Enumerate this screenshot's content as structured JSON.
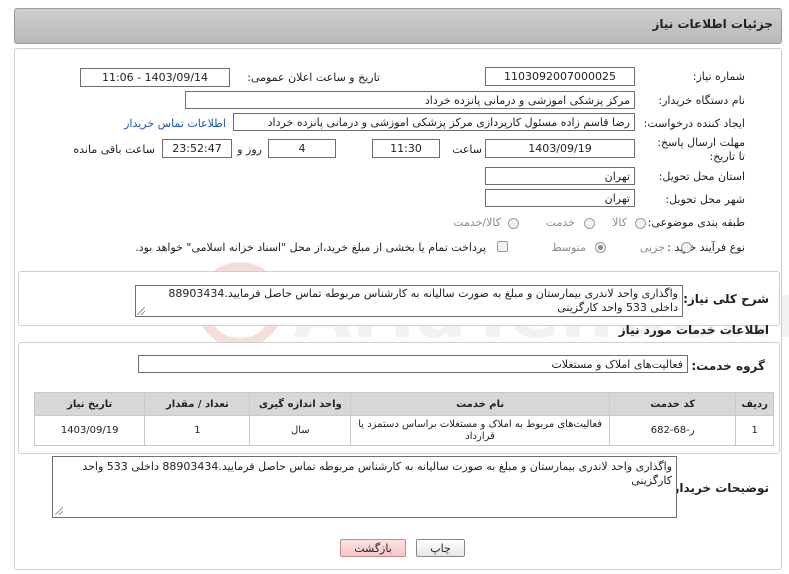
{
  "header": {
    "title": "جزئیات اطلاعات نیاز"
  },
  "form": {
    "need_number_label": "شماره نیاز:",
    "need_number": "1103092007000025",
    "announce_label": "تاریخ و ساعت اعلان عمومی:",
    "announce_value": "1403/09/14 - 11:06",
    "buyer_org_label": "نام دستگاه خریدار:",
    "buyer_org": "مرکز پزشکی  اموزشی و درمانی پانزده خرداد",
    "creator_label": "ایجاد کننده درخواست:",
    "creator": "رضا قاسم زاده مسئول کارپردازی مرکز پزشکی  اموزشی و درمانی پانزده خرداد",
    "buyer_contact_link": "اطلاعات تماس خریدار",
    "deadline_label": "مهلت ارسال پاسخ: تا تاریخ:",
    "deadline_date": "1403/09/19",
    "time_label": "ساعت",
    "deadline_time": "11:30",
    "days_value": "4",
    "days_label": "روز و",
    "remaining_time": "23:52:47",
    "remaining_label": "ساعت باقی مانده",
    "province_label": "استان محل تحویل:",
    "province": "تهران",
    "city_label": "شهر محل تحویل:",
    "city": "تهران",
    "category_label": "طبقه بندی موضوعی:",
    "category_options": [
      "کالا",
      "خدمت",
      "کالا/خدمت"
    ],
    "process_label": "نوع فرآیند خرید :",
    "process_options": [
      "جزیی",
      "متوسط"
    ],
    "payment_note": "پرداخت تمام یا بخشی از مبلغ خرید،از محل \"اسناد خزانه اسلامی\" خواهد بود."
  },
  "summary": {
    "label": "شرح کلی نیاز:",
    "text": "واگذاری واحد لاندری بیمارستان و مبلغ به صورت سالیانه به کارشناس مربوطه تماس حاصل فرمایید.88903434 داخلی 533 واحد کارگزینی"
  },
  "services": {
    "section_title": "اطلاعات خدمات مورد نیاز",
    "group_label": "گروه خدمت:",
    "group_value": "فعالیت‌های  املاک و مستغلات",
    "table": {
      "headers": [
        "ردیف",
        "کد خدمت",
        "نام خدمت",
        "واحد اندازه گیری",
        "تعداد / مقدار",
        "تاریخ نیاز"
      ],
      "rows": [
        [
          "1",
          "ر-68-682",
          "فعالیت‌های مربوط به املاک و مستغلات براساس دستمزد یا قرارداد",
          "سال",
          "1",
          "1403/09/19"
        ]
      ]
    }
  },
  "buyer_notes": {
    "label": "توضیحات خریدار:",
    "text": "واگذاری واحد لاندری بیمارستان و مبلغ به صورت سالیانه به کارشناس مربوطه تماس حاصل فرمایید.88903434 داخلی 533 واحد کارگزینی"
  },
  "buttons": {
    "print": "چاپ",
    "back": "بازگشت"
  },
  "watermark": "AriaTender.neT"
}
